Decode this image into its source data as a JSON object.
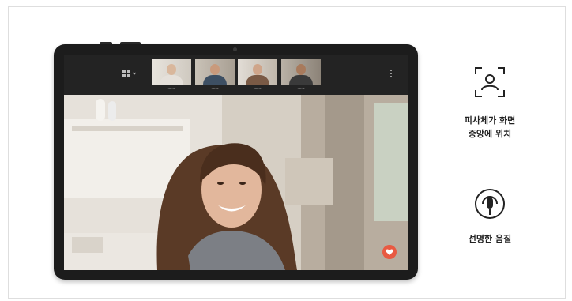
{
  "features": [
    {
      "icon": "face-frame-icon",
      "label_line1": "피사체가 화면",
      "label_line2": "중앙에 위치"
    },
    {
      "icon": "microphone-icon",
      "label_line1": "선명한 음질"
    }
  ],
  "call": {
    "participants": [
      {
        "name": "Name"
      },
      {
        "name": "Name"
      },
      {
        "name": "Name"
      },
      {
        "name": "Name"
      }
    ]
  },
  "colors": {
    "fab": "#e85a42",
    "tablet_body": "#1c1c1c",
    "topbar": "#232323"
  }
}
